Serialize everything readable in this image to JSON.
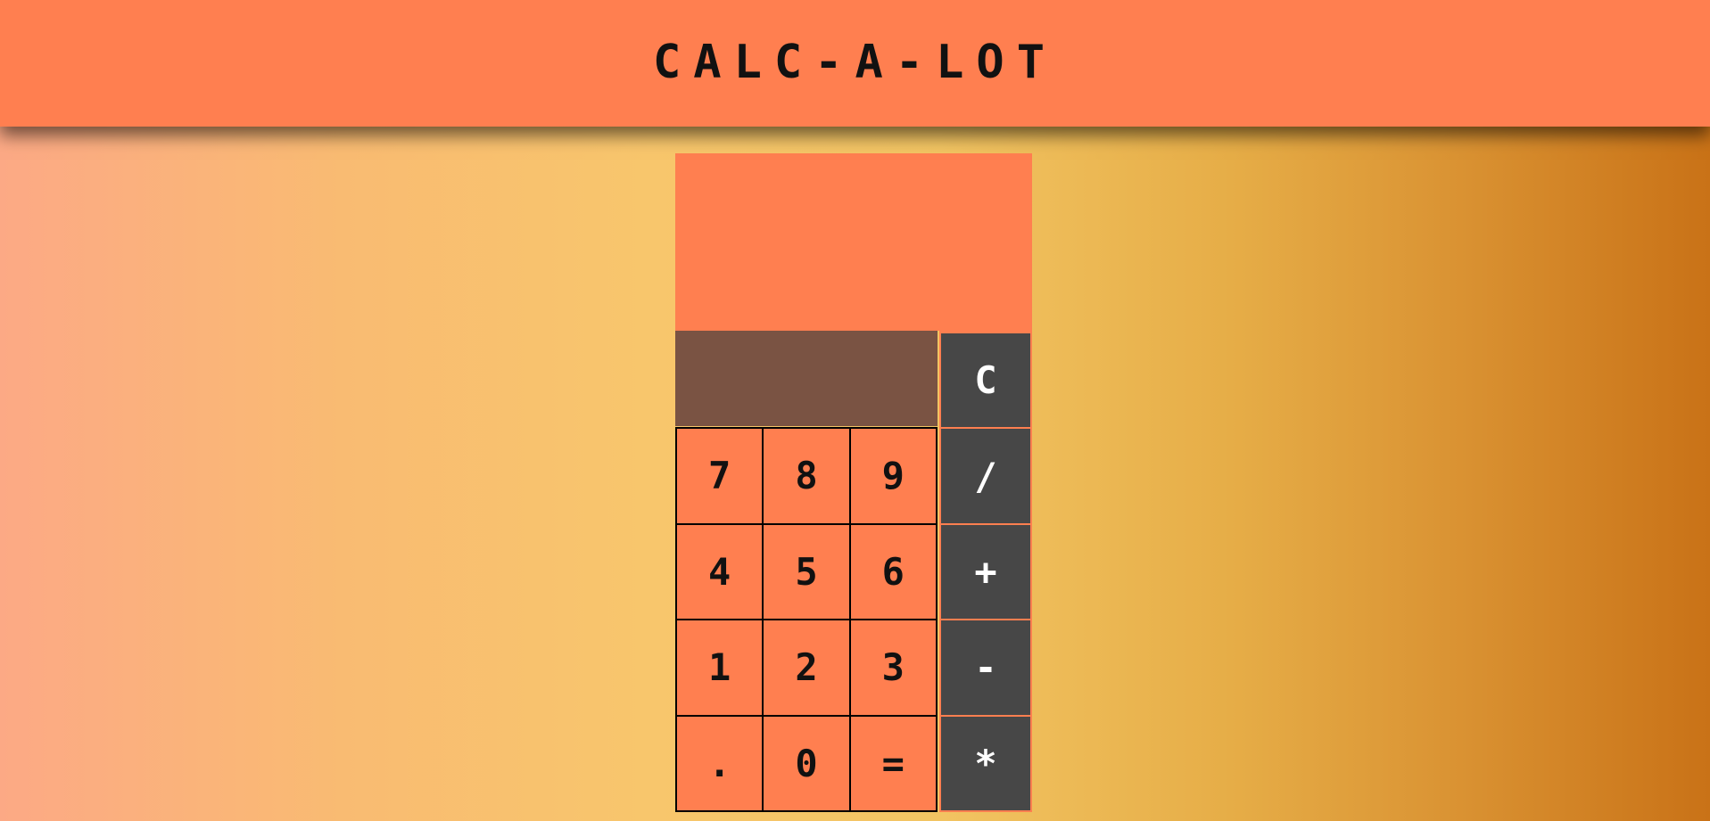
{
  "header": {
    "title": "CALC-A-LOT"
  },
  "calculator": {
    "screen_value": "",
    "input_value": "",
    "number_keys": [
      "7",
      "8",
      "9",
      "4",
      "5",
      "6",
      "1",
      "2",
      "3",
      ".",
      "0",
      "="
    ],
    "operator_keys": [
      "C",
      "/",
      "+",
      "-",
      "*"
    ]
  },
  "colors": {
    "header_bg": "#ff7f50",
    "screen_bg": "#ff7f50",
    "input_bg": "#7a5343",
    "operator_bg": "#474747",
    "background_gradient_start": "#fca985",
    "background_gradient_end": "#c97217"
  }
}
